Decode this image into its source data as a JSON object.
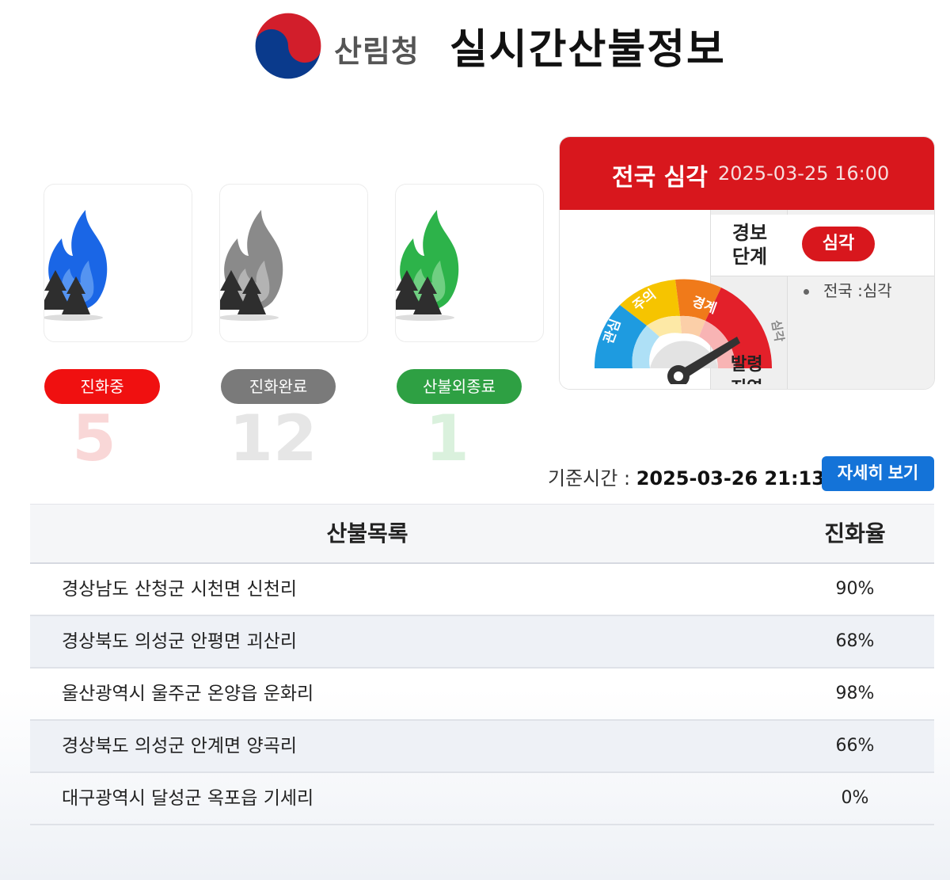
{
  "header": {
    "org_name": "산림청",
    "page_title": "실시간산불정보"
  },
  "status_cards": [
    {
      "label": "진화중",
      "count": "5",
      "color": "#f01010",
      "flame_color": "#1a66e6",
      "count_color": "#f9d7d7"
    },
    {
      "label": "진화완료",
      "count": "12",
      "color": "#7a7a7a",
      "flame_color": "#8a8a8a",
      "count_color": "#e6e6e6"
    },
    {
      "label": "산불외종료",
      "count": "1",
      "color": "#2ea043",
      "flame_color": "#2db34a",
      "count_color": "#daf1dd"
    }
  ],
  "alert": {
    "level_text": "전국 심각",
    "issued_time": "2025-03-25 16:00",
    "label_title": "경보\n단계",
    "severity": "심각",
    "region": "전국 :심각",
    "gauge_segments": [
      "관심",
      "주의",
      "경계",
      "심각"
    ],
    "gauge_caption": "발령\n지역",
    "accent_color": "#d8171d"
  },
  "reference": {
    "label": "기준시간 :",
    "value": "2025-03-26 21:13",
    "detail_button": "자세히 보기"
  },
  "table": {
    "col_name": "산불목록",
    "col_rate": "진화율",
    "rows": [
      {
        "name": "경상남도 산청군 시천면 신천리",
        "rate": "90%"
      },
      {
        "name": "경상북도 의성군 안평면 괴산리",
        "rate": "68%"
      },
      {
        "name": "울산광역시 울주군 온양읍 운화리",
        "rate": "98%"
      },
      {
        "name": "경상북도 의성군 안계면 양곡리",
        "rate": "66%"
      },
      {
        "name": "대구광역시 달성군 옥포읍 기세리",
        "rate": "0%"
      }
    ]
  }
}
